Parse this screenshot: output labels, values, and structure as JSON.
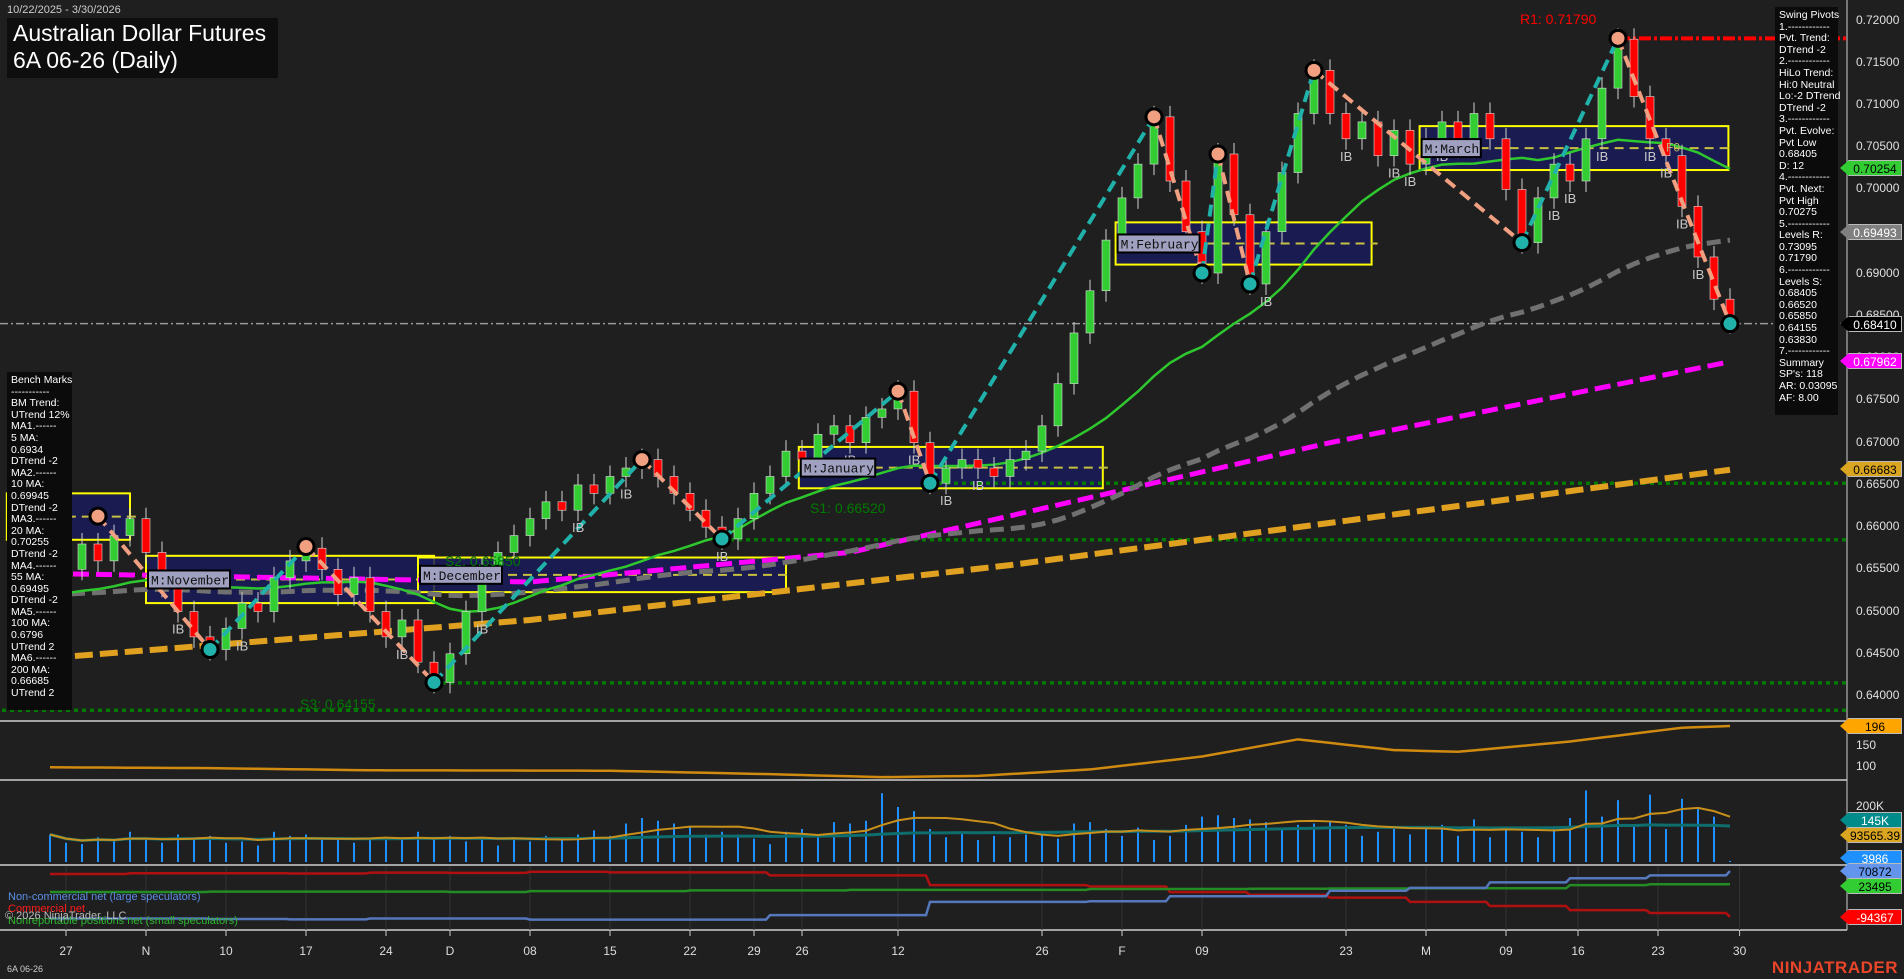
{
  "header": {
    "date_range": "10/22/2025 - 3/30/2026",
    "title_line1": "Australian Dollar Futures",
    "title_line2": "6A 06-26 (Daily)"
  },
  "swing_pivots": {
    "lines": [
      "Swing Pivots",
      "1.------------",
      "Pvt. Trend:",
      "DTrend -2",
      "2.------------",
      "HiLo Trend:",
      "Hi:0 Neutral",
      "Lo:-2 DTrend",
      "DTrend -2",
      "3.------------",
      "Pvt. Evolve:",
      "Pvt Low",
      "0.68405",
      "D: 12",
      "4.------------",
      "Pvt. Next:",
      "Pvt High",
      "0.70275",
      "5.------------",
      "Levels R:",
      "0.73095",
      "0.71790",
      "6.------------",
      "Levels S:",
      "0.68405",
      "0.66520",
      "0.65850",
      "0.64155",
      "0.63830",
      "7.------------",
      "Summary",
      "SP's: 118",
      "AR: 0.03095",
      "AF: 8.00"
    ]
  },
  "bench_marks": {
    "lines": [
      "Bench Marks",
      "-----------",
      "BM Trend:",
      "UTrend 12%",
      "MA1.------",
      "5 MA:",
      "0.6934",
      "DTrend -2",
      "MA2.------",
      "10 MA:",
      "0.69945",
      "DTrend -2",
      "MA3.------",
      "20 MA:",
      "0.70255",
      "DTrend -2",
      "MA4.------",
      "55 MA:",
      "0.69495",
      "DTrend -2",
      "MA5.------",
      "100 MA:",
      "0.6796",
      "UTrend 2",
      "MA6.------",
      "200 MA:",
      "0.66685",
      "UTrend 2"
    ]
  },
  "price_axis": {
    "ticks": [
      "0.72000",
      "0.71500",
      "0.71000",
      "0.70500",
      "0.70000",
      "0.69500",
      "0.69000",
      "0.68500",
      "0.68000",
      "0.67500",
      "0.67000",
      "0.66500",
      "0.66000",
      "0.65500",
      "0.65000",
      "0.64500",
      "0.64000"
    ],
    "markers": [
      {
        "label": "0.70254",
        "value": 0.70254,
        "color": "#32cd32",
        "text_color": "#000"
      },
      {
        "label": "0.69493",
        "value": 0.69493,
        "color": "#808080",
        "text_color": "#fff"
      },
      {
        "label": "0.68410",
        "value": 0.6841,
        "color": "#000000",
        "text_color": "#fff"
      },
      {
        "label": "0.67962",
        "value": 0.67962,
        "color": "#ff00ff",
        "text_color": "#fff"
      },
      {
        "label": "0.66683",
        "value": 0.66683,
        "color": "#daa520",
        "text_color": "#000"
      }
    ]
  },
  "sub_axes": {
    "panel1_ticks": [
      "150",
      "100"
    ],
    "panel1_marker": {
      "label": "196",
      "color": "#ffa500",
      "text_color": "#000"
    },
    "volume_ticks": [
      "200K"
    ],
    "volume_markers": [
      {
        "label": "145K",
        "color": "#008b8b",
        "text_color": "#fff"
      },
      {
        "label": "93565.39",
        "color": "#daa520",
        "text_color": "#000"
      },
      {
        "label": "3986",
        "color": "#1e90ff",
        "text_color": "#fff"
      }
    ],
    "cot_markers": [
      {
        "label": "70872",
        "color": "#6495ed",
        "text_color": "#000"
      },
      {
        "label": "23495",
        "color": "#32cd32",
        "text_color": "#000"
      },
      {
        "label": "-94367",
        "color": "#ff0000",
        "text_color": "#fff"
      }
    ]
  },
  "cot_legend": {
    "noncommercial": "Non-commercial net (large speculators)",
    "commercial": "Commercial net",
    "nonreportable": "Nonreportable positions net (small speculators)",
    "copyright": "© 2026 NinjaTrader, LLC"
  },
  "time_axis": [
    {
      "label": "27",
      "bar": 1
    },
    {
      "label": "N",
      "bar": 6
    },
    {
      "label": "10",
      "bar": 11
    },
    {
      "label": "17",
      "bar": 16
    },
    {
      "label": "24",
      "bar": 21
    },
    {
      "label": "D",
      "bar": 25
    },
    {
      "label": "08",
      "bar": 30
    },
    {
      "label": "15",
      "bar": 35
    },
    {
      "label": "22",
      "bar": 40
    },
    {
      "label": "29",
      "bar": 44
    },
    {
      "label": "26",
      "bar": 47
    },
    {
      "label": "12",
      "bar": 53
    },
    {
      "label": "26",
      "bar": 62
    },
    {
      "label": "F",
      "bar": 67
    },
    {
      "label": "09",
      "bar": 72
    },
    {
      "label": "23",
      "bar": 81
    },
    {
      "label": "M",
      "bar": 86
    },
    {
      "label": "09",
      "bar": 91
    },
    {
      "label": "16",
      "bar": 95.5
    },
    {
      "label": "23",
      "bar": 100.5
    },
    {
      "label": "30",
      "bar": 105.6
    }
  ],
  "footer": {
    "symbol": "6A 06-26",
    "brand": "NINJATRADER"
  },
  "chart_data": {
    "type": "candlestick",
    "title": "Australian Dollar Futures 6A 06-26 (Daily)",
    "ylim": [
      0.637,
      0.7225
    ],
    "closes": [
      0.652,
      0.655,
      0.658,
      0.656,
      0.659,
      0.661,
      0.657,
      0.653,
      0.65,
      0.647,
      0.6455,
      0.648,
      0.651,
      0.65,
      0.654,
      0.656,
      0.6575,
      0.655,
      0.652,
      0.654,
      0.65,
      0.647,
      0.649,
      0.644,
      0.6416,
      0.645,
      0.65,
      0.655,
      0.657,
      0.659,
      0.661,
      0.663,
      0.662,
      0.665,
      0.664,
      0.666,
      0.667,
      0.668,
      0.666,
      0.664,
      0.662,
      0.66,
      0.6586,
      0.661,
      0.664,
      0.666,
      0.669,
      0.668,
      0.671,
      0.672,
      0.67,
      0.673,
      0.674,
      0.6761,
      0.67,
      0.6652,
      0.667,
      0.668,
      0.667,
      0.666,
      0.668,
      0.669,
      0.672,
      0.677,
      0.683,
      0.688,
      0.694,
      0.699,
      0.703,
      0.7086,
      0.701,
      0.695,
      0.6901,
      0.7042,
      0.697,
      0.6888,
      0.695,
      0.702,
      0.709,
      0.7141,
      0.709,
      0.706,
      0.708,
      0.704,
      0.707,
      0.703,
      0.706,
      0.708,
      0.705,
      0.709,
      0.706,
      0.7,
      0.6937,
      0.699,
      0.703,
      0.701,
      0.706,
      0.712,
      0.7178,
      0.711,
      0.706,
      0.704,
      0.698,
      0.692,
      0.687,
      0.6842
    ],
    "volumes_k": [
      100,
      70,
      65,
      90,
      75,
      110,
      85,
      70,
      100,
      85,
      95,
      70,
      75,
      60,
      110,
      95,
      100,
      80,
      85,
      70,
      85,
      85,
      90,
      110,
      85,
      95,
      75,
      85,
      60,
      90,
      75,
      95,
      80,
      100,
      115,
      95,
      140,
      160,
      150,
      140,
      130,
      100,
      110,
      100,
      85,
      65,
      110,
      120,
      95,
      145,
      140,
      150,
      250,
      200,
      185,
      120,
      90,
      110,
      80,
      95,
      90,
      100,
      110,
      85,
      140,
      145,
      120,
      95,
      125,
      80,
      95,
      135,
      165,
      170,
      160,
      155,
      145,
      125,
      135,
      140,
      150,
      135,
      95,
      110,
      120,
      100,
      130,
      135,
      95,
      155,
      90,
      125,
      110,
      90,
      120,
      160,
      260,
      165,
      225,
      135,
      245,
      120,
      230,
      195,
      165,
      4
    ],
    "swing_pivots": [
      {
        "bar": 3,
        "price": 0.6613,
        "type": "high"
      },
      {
        "bar": 10,
        "price": 0.6455,
        "type": "low"
      },
      {
        "bar": 16,
        "price": 0.6577,
        "type": "high"
      },
      {
        "bar": 24,
        "price": 0.6416,
        "type": "low"
      },
      {
        "bar": 37,
        "price": 0.668,
        "type": "high"
      },
      {
        "bar": 42,
        "price": 0.6586,
        "type": "low"
      },
      {
        "bar": 53,
        "price": 0.6761,
        "type": "high"
      },
      {
        "bar": 55,
        "price": 0.6652,
        "type": "low"
      },
      {
        "bar": 69,
        "price": 0.7086,
        "type": "high"
      },
      {
        "bar": 72,
        "price": 0.6901,
        "type": "low"
      },
      {
        "bar": 73,
        "price": 0.7042,
        "type": "high"
      },
      {
        "bar": 75,
        "price": 0.6888,
        "type": "low"
      },
      {
        "bar": 79,
        "price": 0.7141,
        "type": "high"
      },
      {
        "bar": 92,
        "price": 0.6937,
        "type": "low"
      },
      {
        "bar": 98,
        "price": 0.7179,
        "type": "high"
      },
      {
        "bar": 105,
        "price": 0.6841,
        "type": "low"
      }
    ],
    "month_zones": [
      {
        "label": "",
        "from": -2.7,
        "to": 5,
        "high": 0.664,
        "low": 0.6585
      },
      {
        "label": "M:November",
        "from": 6,
        "to": 24,
        "high": 0.6566,
        "low": 0.651
      },
      {
        "label": "M:December",
        "from": 23,
        "to": 46,
        "high": 0.6564,
        "low": 0.6523
      },
      {
        "label": "M:January",
        "from": 46.8,
        "to": 65.8,
        "high": 0.6695,
        "low": 0.6646
      },
      {
        "label": "M:February",
        "from": 66.6,
        "to": 82.6,
        "high": 0.6961,
        "low": 0.6911
      },
      {
        "label": "M:March",
        "from": 85.6,
        "to": 104.9,
        "high": 0.7075,
        "low": 0.7023
      }
    ],
    "levels": [
      {
        "label": "R1: 0.71790",
        "value": 0.7179,
        "color": "#ff0000",
        "from": 98
      },
      {
        "label": "S1: 0.66520",
        "value": 0.6652,
        "color": "#007a00",
        "from": 55
      },
      {
        "label": "S2: 0.65850",
        "value": 0.6585,
        "color": "#007a00",
        "from": 42
      },
      {
        "label": "S3: 0.64155",
        "value": 0.64155,
        "color": "#007a00",
        "from": 24
      },
      {
        "label": "",
        "value": 0.6383,
        "color": "#007a00",
        "from": -3
      }
    ],
    "last_price": 0.6841,
    "ma_100": [
      [
        0,
        0.6545
      ],
      [
        30,
        0.6535
      ],
      [
        50,
        0.657
      ],
      [
        80,
        0.67
      ],
      [
        105,
        0.6796
      ]
    ],
    "ma_200": [
      [
        0,
        0.6445
      ],
      [
        30,
        0.649
      ],
      [
        60,
        0.6555
      ],
      [
        90,
        0.663
      ],
      [
        105,
        0.6668
      ]
    ],
    "ib_bars": [
      8,
      12,
      22,
      27,
      33,
      36,
      42,
      50,
      54,
      56,
      58,
      76,
      81,
      84,
      85,
      87,
      94,
      95,
      97,
      100,
      101,
      102,
      103
    ],
    "f0_bar": 101,
    "panel1_series": [
      [
        0,
        100
      ],
      [
        10,
        98
      ],
      [
        20,
        93
      ],
      [
        35,
        92
      ],
      [
        45,
        84
      ],
      [
        52,
        77
      ],
      [
        58,
        80
      ],
      [
        65,
        95
      ],
      [
        72,
        125
      ],
      [
        78,
        165
      ],
      [
        84,
        140
      ],
      [
        88,
        136
      ],
      [
        95,
        160
      ],
      [
        102,
        192
      ],
      [
        105,
        196
      ]
    ],
    "cot": {
      "week_bars": [
        0,
        5,
        10,
        15,
        20,
        25,
        30,
        35,
        40,
        45,
        50,
        55,
        60,
        65,
        70,
        75,
        80,
        85,
        90,
        95,
        100,
        105
      ],
      "noncommercial": [
        -100000,
        -100000,
        -102000,
        -103000,
        -100000,
        -100000,
        -104000,
        -104000,
        -104000,
        -88000,
        -88000,
        -40000,
        -40000,
        -38000,
        -20000,
        -20000,
        0,
        10000,
        30000,
        45000,
        55000,
        70872
      ],
      "commercial": [
        60000,
        63000,
        63000,
        62000,
        65000,
        64000,
        68000,
        66000,
        66000,
        55000,
        55000,
        20000,
        20000,
        15000,
        -5000,
        -15000,
        -25000,
        -40000,
        -55000,
        -70000,
        -80000,
        -94367
      ],
      "nonreportable": [
        -4700,
        -4700,
        -3500,
        -3500,
        -3500,
        -4700,
        -1500,
        -1500,
        1000,
        1000,
        3000,
        3000,
        3000,
        6000,
        6000,
        7000,
        8000,
        9000,
        9000,
        20000,
        23000,
        23495
      ]
    }
  }
}
